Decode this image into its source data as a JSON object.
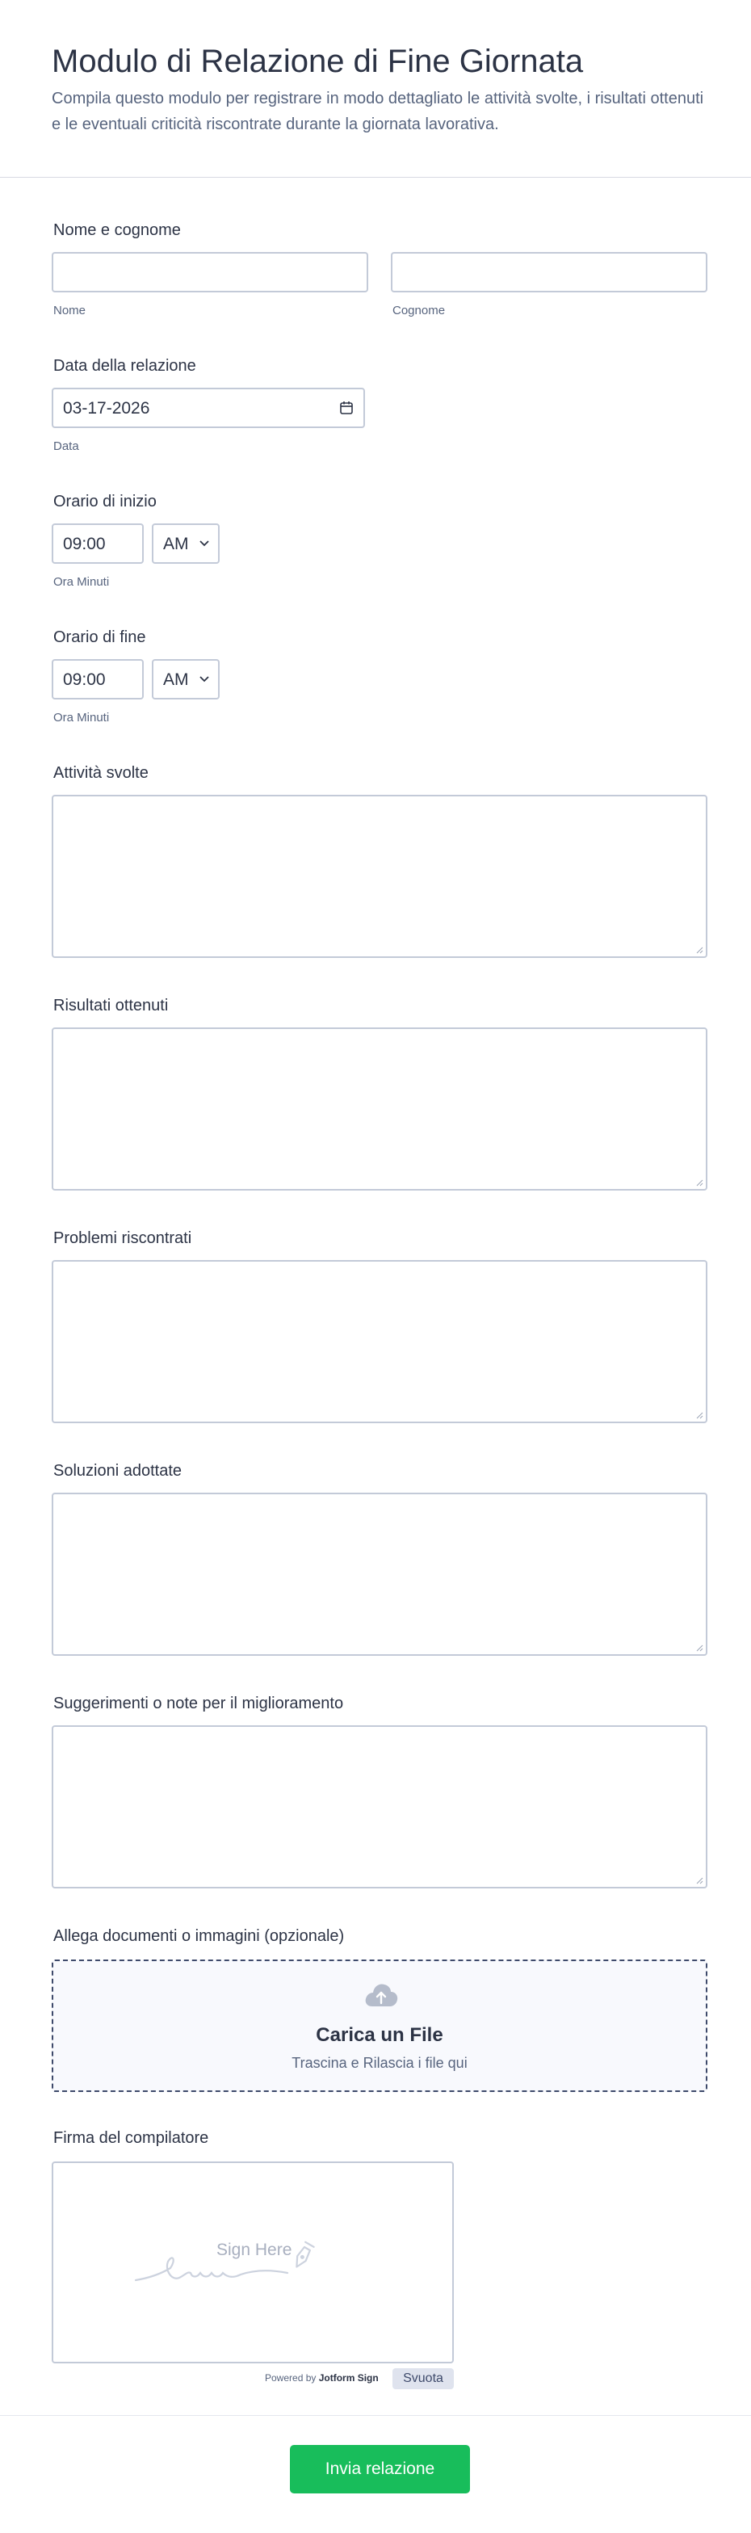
{
  "form": {
    "title": "Modulo di Relazione di Fine Giornata",
    "description": "Compila questo modulo per registrare in modo dettagliato le attività svolte, i risultati ottenuti e le eventuali criticità riscontrate durante la giornata lavorativa."
  },
  "name": {
    "label": "Nome e cognome",
    "first_sublabel": "Nome",
    "last_sublabel": "Cognome",
    "first_value": "",
    "last_value": ""
  },
  "date": {
    "label": "Data della relazione",
    "value": "03-17-2026",
    "sublabel": "Data",
    "icon": "calendar-icon"
  },
  "start_time": {
    "label": "Orario di inizio",
    "time": "09:00",
    "ampm": "AM",
    "sublabel": "Ora Minuti"
  },
  "end_time": {
    "label": "Orario di fine",
    "time": "09:00",
    "ampm": "AM",
    "sublabel": "Ora Minuti"
  },
  "textareas": {
    "activities": "Attività svolte",
    "results": "Risultati ottenuti",
    "problems": "Problemi riscontrati",
    "solutions": "Soluzioni adottate",
    "suggestions": "Suggerimenti o note per il miglioramento"
  },
  "upload": {
    "label": "Allega documenti o immagini (opzionale)",
    "title": "Carica un File",
    "subtitle": "Trascina e Rilascia i file qui",
    "icon": "cloud-upload-icon"
  },
  "signature": {
    "label": "Firma del compilatore",
    "placeholder": "Sign Here",
    "powered_prefix": "Powered by",
    "powered_brand": "Jotform Sign",
    "clear_label": "Svuota"
  },
  "submit_label": "Invia relazione",
  "colors": {
    "accent": "#18bd5b",
    "text": "#2c3345",
    "muted": "#57647e",
    "border": "#c3cad8"
  }
}
